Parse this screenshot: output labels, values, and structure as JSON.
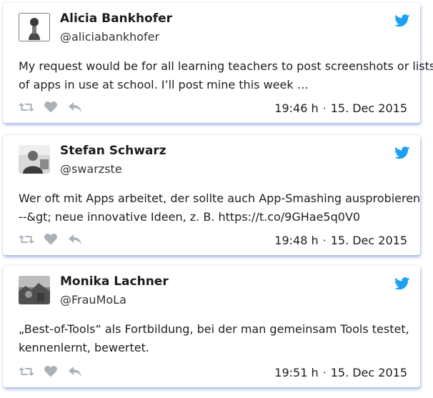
{
  "colors": {
    "twitter_blue": "#1da1f2",
    "action_gray": "#a9b2ba",
    "card_shadow": "#4670c8"
  },
  "tweets": [
    {
      "name": "Alicia Bankhofer",
      "handle": "@aliciabankhofer",
      "avatar_icon": "avatar-illustrated-woman-icon",
      "text_lines": [
        "My request would be for all learning teachers to post screenshots or lists",
        "of apps in use at school. I’ll post mine this week …"
      ],
      "time": "19:46 h",
      "separator": "·",
      "date": "15. Dec 2015"
    },
    {
      "name": "Stefan Schwarz",
      "handle": "@swarzste",
      "avatar_icon": "avatar-photo-man-icon",
      "text_lines": [
        "Wer oft mit Apps arbeitet, der sollte auch App-Smashing ausprobieren",
        "--&gt; neue innovative Ideen, z. B. https://t.co/9GHae5q0V0"
      ],
      "time": "19:48 h",
      "separator": "·",
      "date": "15. Dec 2015"
    },
    {
      "name": "Monika Lachner",
      "handle": "@FrauMoLa",
      "avatar_icon": "avatar-photo-landscape-icon",
      "text_lines": [
        "„Best-of-Tools“ als Fortbildung, bei der man gemeinsam Tools testet,",
        "kennenlernt, bewertet."
      ],
      "time": "19:51 h",
      "separator": "·",
      "date": "15. Dec 2015"
    }
  ]
}
